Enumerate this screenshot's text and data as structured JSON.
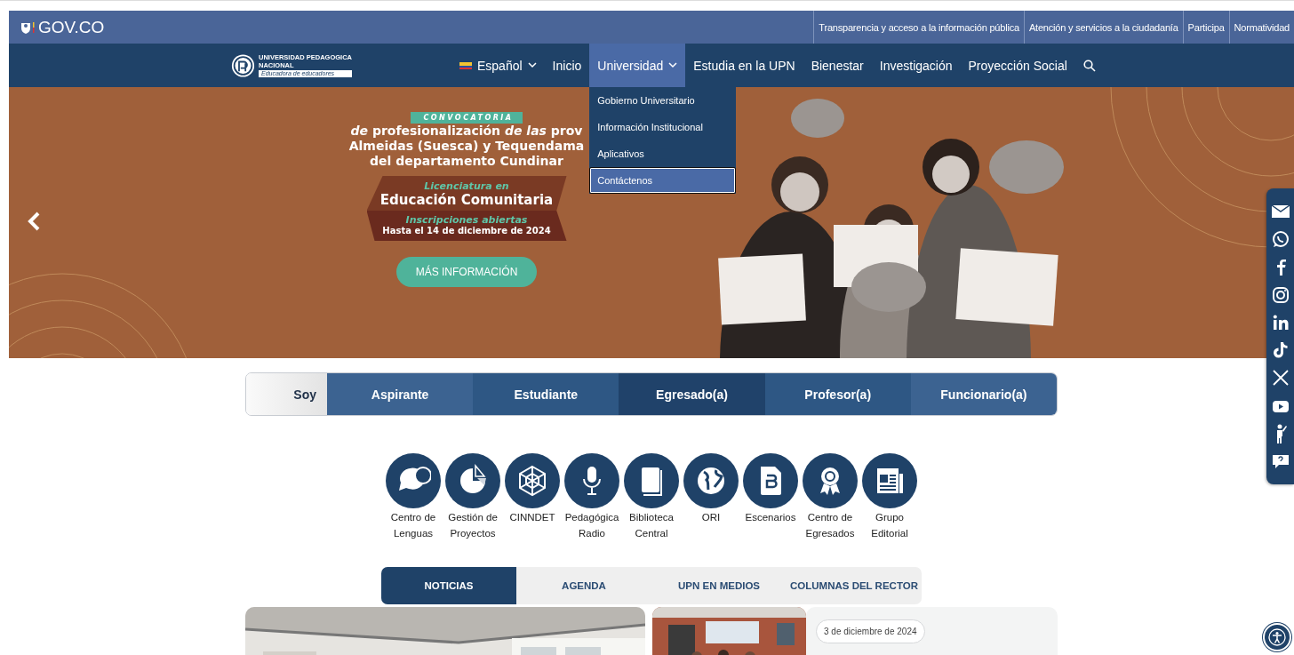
{
  "gov_bar": {
    "logo": "GOV.CO",
    "links": [
      {
        "label": "Transparencia y acceso a la información pública"
      },
      {
        "label": "Atención y servicios a la ciudadanía"
      },
      {
        "label": "Participa"
      },
      {
        "label": "Normatividad"
      }
    ]
  },
  "nav": {
    "logo_title": "UNIVERSIDAD PEDAGOGICA",
    "logo_subtitle": "NACIONAL",
    "logo_tagline": "Educadora de educadores",
    "items": [
      {
        "label": "Español",
        "kind": "language",
        "selected": false
      },
      {
        "label": "Inicio",
        "kind": "link",
        "selected": false
      },
      {
        "label": "Universidad",
        "kind": "dropdown",
        "selected": true
      },
      {
        "label": "Estudia en la UPN",
        "kind": "link",
        "selected": false
      },
      {
        "label": "Bienestar",
        "kind": "link",
        "selected": false
      },
      {
        "label": "Investigación",
        "kind": "link",
        "selected": false
      },
      {
        "label": "Proyección Social",
        "kind": "link",
        "selected": false
      }
    ],
    "dropdown": [
      {
        "label": "Gobierno Universitario",
        "selected": false
      },
      {
        "label": "Información Institucional",
        "selected": false
      },
      {
        "label": "Aplicativos",
        "selected": false
      },
      {
        "label": "Contáctenos",
        "selected": true
      }
    ]
  },
  "banner": {
    "tag": "CONVOCATORIA",
    "heading": [
      "*de* profesionalización *de las* prov",
      "Almeidas (Suesca) y Tequendama",
      "del departamento Cundinar"
    ],
    "program_kicker": "Licenciatura en",
    "program": "Educación Comunitaria",
    "status": "Inscripciones abiertas",
    "deadline": "Hasta el 14 de diciembre de 2024",
    "button": "MÁS INFORMACIÓN",
    "photo": {
      "kind": "picture"
    }
  },
  "audience": {
    "label": "Soy",
    "options": [
      {
        "label": "Aspirante"
      },
      {
        "label": "Estudiante"
      },
      {
        "label": "Egresado(a)"
      },
      {
        "label": "Profesor(a)"
      },
      {
        "label": "Funcionario(a)"
      }
    ]
  },
  "quick_links": [
    {
      "label": "Centro de Lenguas"
    },
    {
      "label": "Gestión de Proyectos"
    },
    {
      "label": "CINNDET"
    },
    {
      "label": "Pedagógica Radio"
    },
    {
      "label": "Biblioteca Central"
    },
    {
      "label": "ORI"
    },
    {
      "label": "Escenarios"
    },
    {
      "label": "Centro de Egresados"
    },
    {
      "label": "Grupo Editorial"
    }
  ],
  "news_tabs": [
    {
      "label": "NOTICIAS",
      "selected": true
    },
    {
      "label": "AGENDA",
      "selected": false
    },
    {
      "label": "UPN EN MEDIOS",
      "selected": false
    },
    {
      "label": "COLUMNAS DEL RECTOR",
      "selected": false
    }
  ],
  "news": {
    "cards": [
      {
        "kind": "picture"
      },
      {
        "kind": "picture"
      }
    ],
    "date": "3 de diciembre de 2024"
  }
}
